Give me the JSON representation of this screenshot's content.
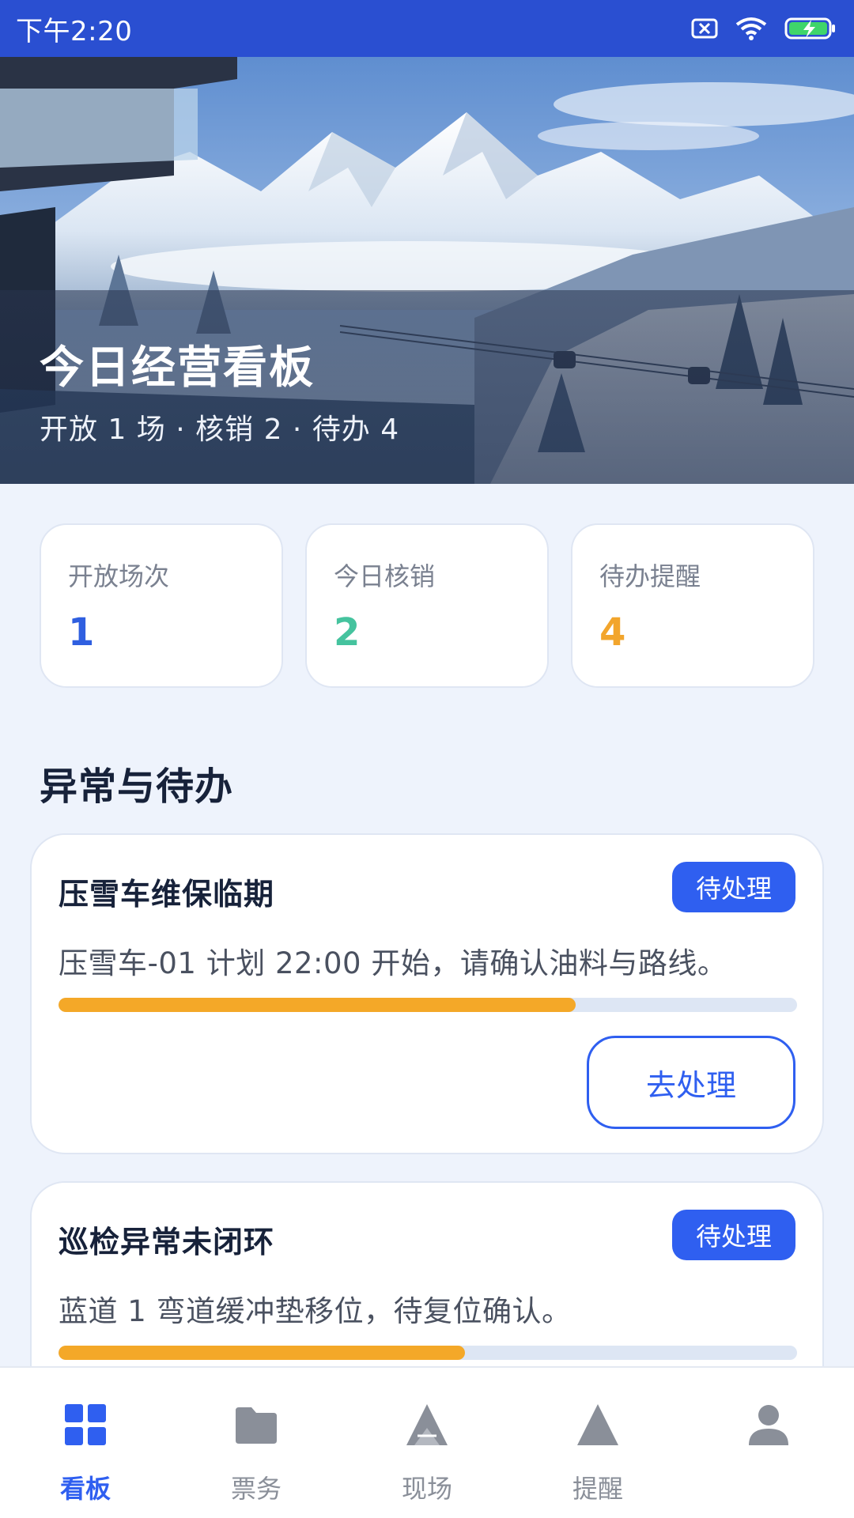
{
  "status_bar": {
    "time": "下午2:20"
  },
  "hero": {
    "title": "今日经营看板",
    "subtitle": "开放 1 场 · 核销 2 · 待办 4"
  },
  "stats": [
    {
      "label": "开放场次",
      "value": "1",
      "color": "#2f5fe0"
    },
    {
      "label": "今日核销",
      "value": "2",
      "color": "#45c39e"
    },
    {
      "label": "待办提醒",
      "value": "4",
      "color": "#f2a52c"
    }
  ],
  "section": {
    "title": "异常与待办"
  },
  "tasks": [
    {
      "title": "压雪车维保临期",
      "badge": "待处理",
      "description": "压雪车-01 计划 22:00 开始，请确认油料与路线。",
      "progress": 0.7,
      "action": "去处理"
    },
    {
      "title": "巡检异常未闭环",
      "badge": "待处理",
      "description": "蓝道 1 弯道缓冲垫移位，待复位确认。",
      "progress": 0.55
    }
  ],
  "nav": {
    "items": [
      {
        "label": "看板",
        "icon": "grid-icon",
        "active": true
      },
      {
        "label": "票务",
        "icon": "folder-icon",
        "active": false
      },
      {
        "label": "现场",
        "icon": "ski-slope-icon",
        "active": false
      },
      {
        "label": "提醒",
        "icon": "triangle-icon",
        "active": false
      },
      {
        "label": "",
        "icon": "user-icon",
        "active": false
      }
    ]
  },
  "colors": {
    "primary": "#2f5ff0",
    "status_bar": "#2a4fd1",
    "progress": "#f4a828",
    "background": "#eef3fc"
  }
}
